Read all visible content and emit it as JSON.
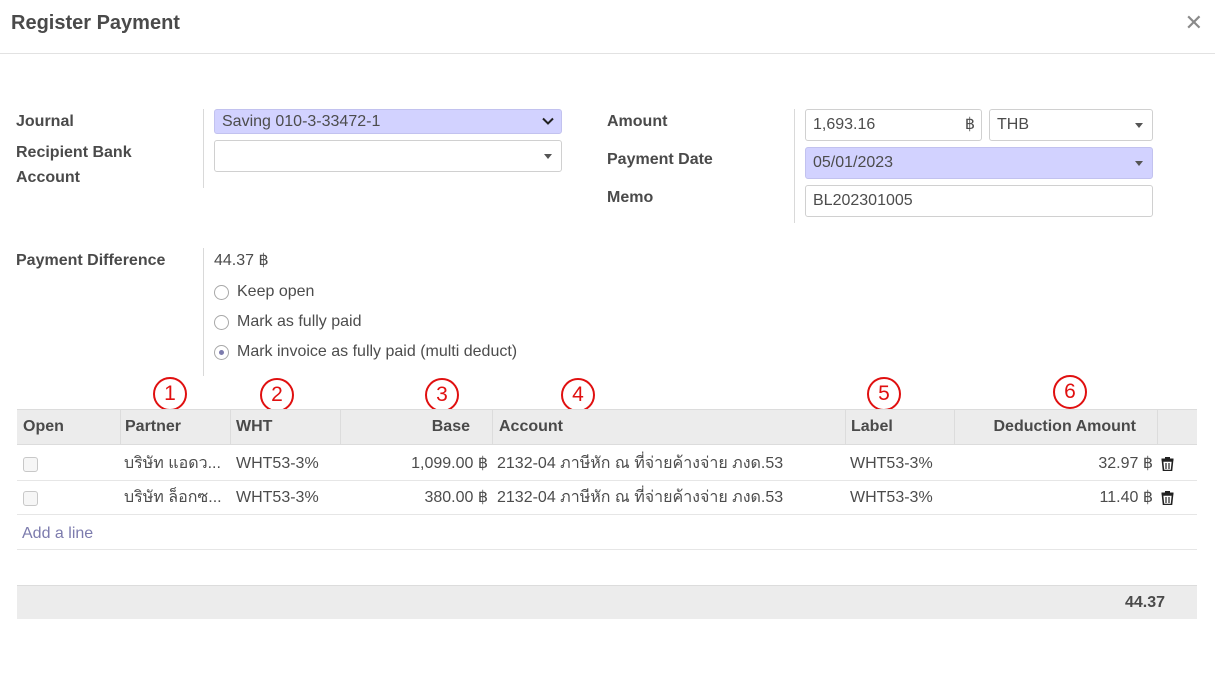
{
  "dialog": {
    "title": "Register Payment",
    "close_icon": "close-icon"
  },
  "form": {
    "journal_label": "Journal",
    "journal_value": "Saving 010-3-33472-1",
    "recipient_bank_label_line1": "Recipient Bank",
    "recipient_bank_label_line2": "Account",
    "recipient_bank_value": "",
    "amount_label": "Amount",
    "amount_value": "1,693.16",
    "amount_currency_symbol": "฿",
    "currency_value": "THB",
    "payment_date_label": "Payment Date",
    "payment_date_value": "05/01/2023",
    "memo_label": "Memo",
    "memo_value": "BL202301005",
    "payment_difference_label": "Payment Difference",
    "payment_difference_value": "44.37 ฿",
    "options": [
      {
        "label": "Keep open",
        "selected": false
      },
      {
        "label": "Mark as fully paid",
        "selected": false
      },
      {
        "label": "Mark invoice as fully paid (multi deduct)",
        "selected": true
      }
    ]
  },
  "annotations": [
    "1",
    "2",
    "3",
    "4",
    "5",
    "6"
  ],
  "table": {
    "columns": {
      "open": "Open",
      "partner": "Partner",
      "wht": "WHT",
      "base": "Base",
      "account": "Account",
      "label": "Label",
      "deduction_amount": "Deduction Amount"
    },
    "rows": [
      {
        "partner": "บริษัท แอดว...",
        "wht": "WHT53-3%",
        "base": "1,099.00 ฿",
        "account": "2132-04 ภาษีหัก ณ ที่จ่ายค้างจ่าย ภงด.53",
        "label": "WHT53-3%",
        "deduction_amount": "32.97 ฿"
      },
      {
        "partner": "บริษัท ล็อกซ...",
        "wht": "WHT53-3%",
        "base": "380.00 ฿",
        "account": "2132-04 ภาษีหัก ณ ที่จ่ายค้างจ่าย ภงด.53",
        "label": "WHT53-3%",
        "deduction_amount": "11.40 ฿"
      }
    ],
    "add_line": "Add a line",
    "total": "44.37"
  },
  "colors": {
    "highlight_field": "#d2d2ff",
    "link": "#7c7bad",
    "annotation": "#e01010"
  }
}
